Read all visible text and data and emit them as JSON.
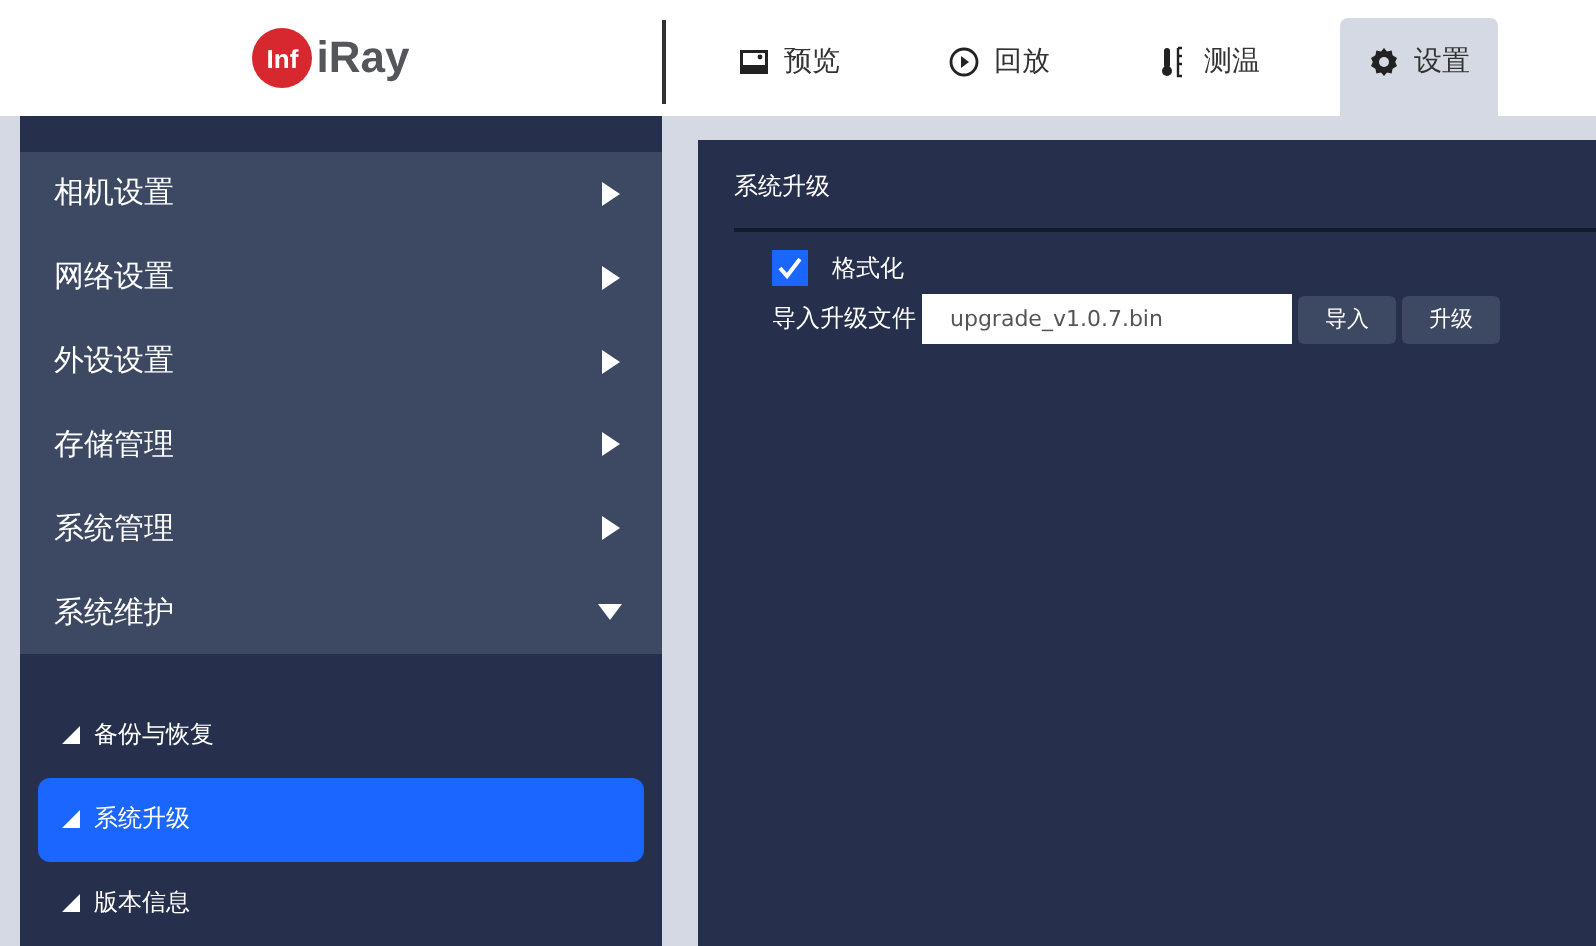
{
  "logo": {
    "mark": "Inf",
    "text": "iRay"
  },
  "tabs": [
    {
      "label": "预览",
      "kind": "preview",
      "selected": false
    },
    {
      "label": "回放",
      "kind": "playback",
      "selected": false
    },
    {
      "label": "测温",
      "kind": "temperature",
      "selected": false
    },
    {
      "label": "设置",
      "kind": "settings",
      "selected": true
    }
  ],
  "sidebar": {
    "items": [
      {
        "label": "相机设置",
        "expanded": false
      },
      {
        "label": "网络设置",
        "expanded": false
      },
      {
        "label": "外设设置",
        "expanded": false
      },
      {
        "label": "存储管理",
        "expanded": false
      },
      {
        "label": "系统管理",
        "expanded": false
      },
      {
        "label": "系统维护",
        "expanded": true,
        "children": [
          {
            "label": "备份与恢复",
            "selected": false
          },
          {
            "label": "系统升级",
            "selected": true
          },
          {
            "label": "版本信息",
            "selected": false
          }
        ]
      }
    ]
  },
  "panel": {
    "title": "系统升级",
    "format": {
      "label": "格式化",
      "checked": true
    },
    "file": {
      "label": "导入升级文件",
      "value": "upgrade_v1.0.7.bin"
    },
    "buttons": [
      "导入",
      "升级"
    ]
  }
}
